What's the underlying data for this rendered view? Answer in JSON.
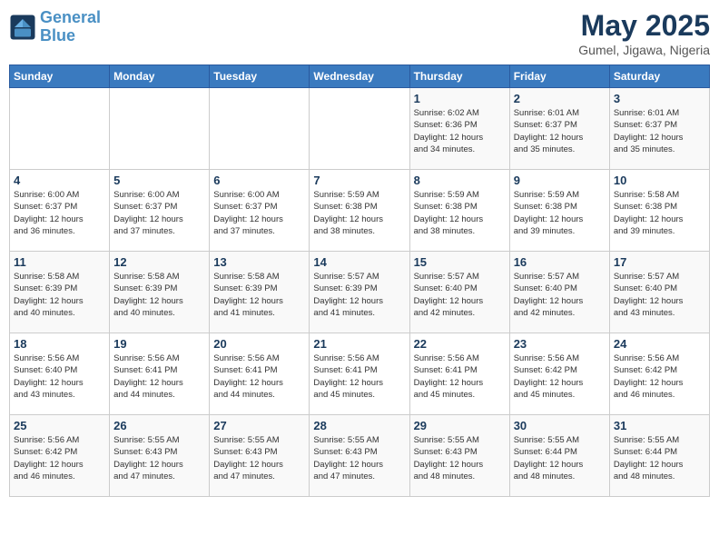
{
  "logo": {
    "text_general": "General",
    "text_blue": "Blue"
  },
  "header": {
    "month_year": "May 2025",
    "location": "Gumel, Jigawa, Nigeria"
  },
  "weekdays": [
    "Sunday",
    "Monday",
    "Tuesday",
    "Wednesday",
    "Thursday",
    "Friday",
    "Saturday"
  ],
  "weeks": [
    [
      {
        "day": "",
        "info": ""
      },
      {
        "day": "",
        "info": ""
      },
      {
        "day": "",
        "info": ""
      },
      {
        "day": "",
        "info": ""
      },
      {
        "day": "1",
        "info": "Sunrise: 6:02 AM\nSunset: 6:36 PM\nDaylight: 12 hours\nand 34 minutes."
      },
      {
        "day": "2",
        "info": "Sunrise: 6:01 AM\nSunset: 6:37 PM\nDaylight: 12 hours\nand 35 minutes."
      },
      {
        "day": "3",
        "info": "Sunrise: 6:01 AM\nSunset: 6:37 PM\nDaylight: 12 hours\nand 35 minutes."
      }
    ],
    [
      {
        "day": "4",
        "info": "Sunrise: 6:00 AM\nSunset: 6:37 PM\nDaylight: 12 hours\nand 36 minutes."
      },
      {
        "day": "5",
        "info": "Sunrise: 6:00 AM\nSunset: 6:37 PM\nDaylight: 12 hours\nand 37 minutes."
      },
      {
        "day": "6",
        "info": "Sunrise: 6:00 AM\nSunset: 6:37 PM\nDaylight: 12 hours\nand 37 minutes."
      },
      {
        "day": "7",
        "info": "Sunrise: 5:59 AM\nSunset: 6:38 PM\nDaylight: 12 hours\nand 38 minutes."
      },
      {
        "day": "8",
        "info": "Sunrise: 5:59 AM\nSunset: 6:38 PM\nDaylight: 12 hours\nand 38 minutes."
      },
      {
        "day": "9",
        "info": "Sunrise: 5:59 AM\nSunset: 6:38 PM\nDaylight: 12 hours\nand 39 minutes."
      },
      {
        "day": "10",
        "info": "Sunrise: 5:58 AM\nSunset: 6:38 PM\nDaylight: 12 hours\nand 39 minutes."
      }
    ],
    [
      {
        "day": "11",
        "info": "Sunrise: 5:58 AM\nSunset: 6:39 PM\nDaylight: 12 hours\nand 40 minutes."
      },
      {
        "day": "12",
        "info": "Sunrise: 5:58 AM\nSunset: 6:39 PM\nDaylight: 12 hours\nand 40 minutes."
      },
      {
        "day": "13",
        "info": "Sunrise: 5:58 AM\nSunset: 6:39 PM\nDaylight: 12 hours\nand 41 minutes."
      },
      {
        "day": "14",
        "info": "Sunrise: 5:57 AM\nSunset: 6:39 PM\nDaylight: 12 hours\nand 41 minutes."
      },
      {
        "day": "15",
        "info": "Sunrise: 5:57 AM\nSunset: 6:40 PM\nDaylight: 12 hours\nand 42 minutes."
      },
      {
        "day": "16",
        "info": "Sunrise: 5:57 AM\nSunset: 6:40 PM\nDaylight: 12 hours\nand 42 minutes."
      },
      {
        "day": "17",
        "info": "Sunrise: 5:57 AM\nSunset: 6:40 PM\nDaylight: 12 hours\nand 43 minutes."
      }
    ],
    [
      {
        "day": "18",
        "info": "Sunrise: 5:56 AM\nSunset: 6:40 PM\nDaylight: 12 hours\nand 43 minutes."
      },
      {
        "day": "19",
        "info": "Sunrise: 5:56 AM\nSunset: 6:41 PM\nDaylight: 12 hours\nand 44 minutes."
      },
      {
        "day": "20",
        "info": "Sunrise: 5:56 AM\nSunset: 6:41 PM\nDaylight: 12 hours\nand 44 minutes."
      },
      {
        "day": "21",
        "info": "Sunrise: 5:56 AM\nSunset: 6:41 PM\nDaylight: 12 hours\nand 45 minutes."
      },
      {
        "day": "22",
        "info": "Sunrise: 5:56 AM\nSunset: 6:41 PM\nDaylight: 12 hours\nand 45 minutes."
      },
      {
        "day": "23",
        "info": "Sunrise: 5:56 AM\nSunset: 6:42 PM\nDaylight: 12 hours\nand 45 minutes."
      },
      {
        "day": "24",
        "info": "Sunrise: 5:56 AM\nSunset: 6:42 PM\nDaylight: 12 hours\nand 46 minutes."
      }
    ],
    [
      {
        "day": "25",
        "info": "Sunrise: 5:56 AM\nSunset: 6:42 PM\nDaylight: 12 hours\nand 46 minutes."
      },
      {
        "day": "26",
        "info": "Sunrise: 5:55 AM\nSunset: 6:43 PM\nDaylight: 12 hours\nand 47 minutes."
      },
      {
        "day": "27",
        "info": "Sunrise: 5:55 AM\nSunset: 6:43 PM\nDaylight: 12 hours\nand 47 minutes."
      },
      {
        "day": "28",
        "info": "Sunrise: 5:55 AM\nSunset: 6:43 PM\nDaylight: 12 hours\nand 47 minutes."
      },
      {
        "day": "29",
        "info": "Sunrise: 5:55 AM\nSunset: 6:43 PM\nDaylight: 12 hours\nand 48 minutes."
      },
      {
        "day": "30",
        "info": "Sunrise: 5:55 AM\nSunset: 6:44 PM\nDaylight: 12 hours\nand 48 minutes."
      },
      {
        "day": "31",
        "info": "Sunrise: 5:55 AM\nSunset: 6:44 PM\nDaylight: 12 hours\nand 48 minutes."
      }
    ]
  ]
}
